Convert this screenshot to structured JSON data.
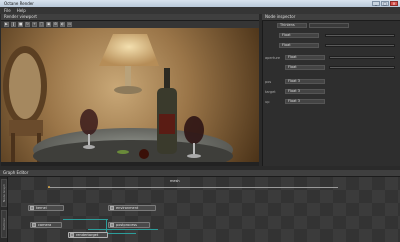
{
  "window": {
    "title": "Octane Render",
    "minimize": "_",
    "maximize": "□",
    "close": "×"
  },
  "menu": [
    {
      "label": "File"
    },
    {
      "label": "Help"
    }
  ],
  "render_viewport": {
    "header": "Render viewport"
  },
  "node_inspector": {
    "header": "Node inspector",
    "rows": [
      {
        "label": "",
        "value": "Thinlens"
      },
      {
        "label": "",
        "value": "Float"
      },
      {
        "label": "",
        "value": "Float"
      },
      {
        "label": "aperture",
        "value": "Float"
      },
      {
        "label": "",
        "value": "Float"
      },
      {
        "label": "pos",
        "value": "Float 3"
      },
      {
        "label": "target",
        "value": "Float 3"
      },
      {
        "label": "up",
        "value": "Float 3"
      }
    ]
  },
  "graph_editor": {
    "header": "Graph Editor",
    "side_tabs": [
      "Node Graph",
      "Outliner"
    ],
    "top_node": "mesh",
    "nodes": [
      {
        "label": "kernel",
        "name": "kernel-node"
      },
      {
        "label": "environment",
        "name": "environment-node"
      },
      {
        "label": "camera",
        "name": "camera-node"
      },
      {
        "label": "postprocess",
        "name": "postprocess-node"
      },
      {
        "label": "rendertarget",
        "name": "rendertarget-node"
      }
    ]
  },
  "colors": {
    "accent": "#2c9d9a",
    "panel": "#2e2e2e",
    "titlebar": "#c9d6e4"
  }
}
